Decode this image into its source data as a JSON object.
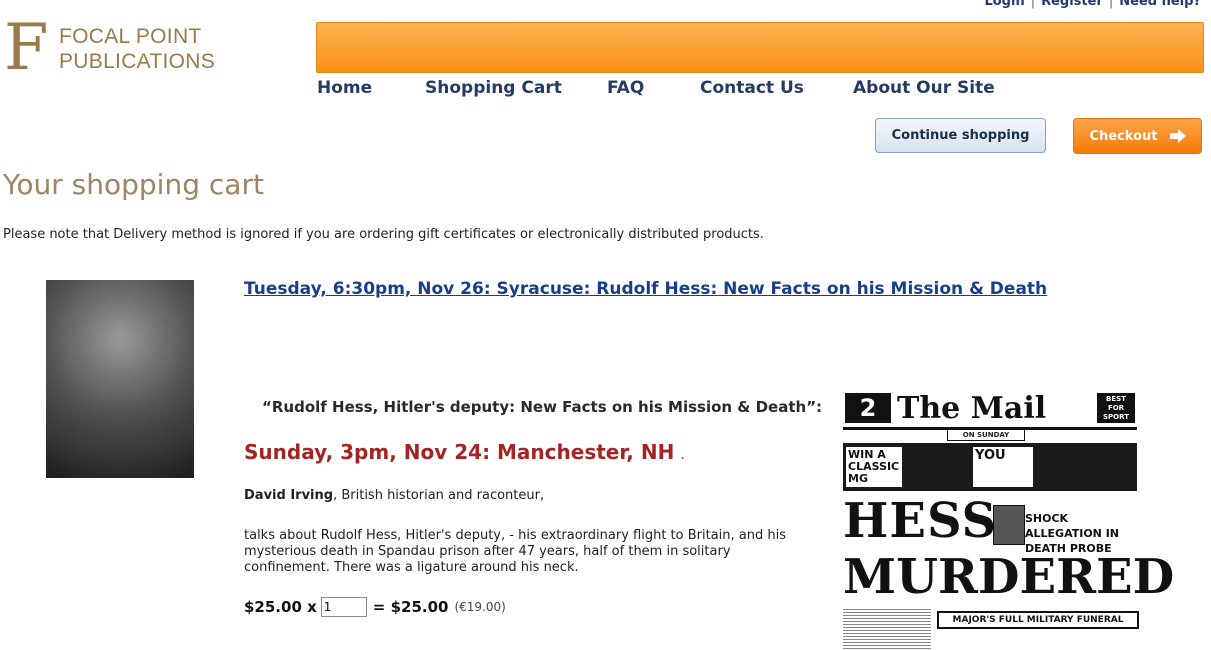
{
  "header": {
    "top_links": [
      "Login",
      "Register",
      "Need help?"
    ],
    "logo": {
      "letter": "F",
      "line1": "FOCAL POINT",
      "line2": "PUBLICATIONS"
    },
    "nav": [
      "Home",
      "Shopping Cart",
      "FAQ",
      "Contact Us",
      "About Our Site"
    ]
  },
  "buttons": {
    "continue": "Continue shopping",
    "checkout": "Checkout"
  },
  "page": {
    "title": "Your shopping cart",
    "note": "Please note that Delivery method is ignored if you are ordering gift certificates or electronically distributed products."
  },
  "item": {
    "link_text": "Tuesday, 6:30pm, Nov 26: Syracuse: Rudolf Hess: New Facts on his Mission & Death",
    "quote": "“Rudolf Hess, Hitler's deputy: New Facts on his Mission & Death”:",
    "date_line": "Sunday, 3pm, Nov 24: Manchester, NH",
    "date_dot": ".",
    "author_name": "David Irving",
    "author_rest": ", British historian and raconteur,",
    "description": "talks about  Rudolf Hess, Hitler's deputy, - his extraordinary flight to Britain, and his mysterious death in Spandau prison after 47 years, half of them in solitary confinement. There was a ligature around his neck.",
    "unit_price": "$25.00 x",
    "quantity": "1",
    "total": "= $25.00",
    "total_eur": "(€19.00)"
  },
  "newspaper": {
    "number": "2",
    "title": "The Mail",
    "badge": "BEST FOR SPORT",
    "sunday": "ON SUNDAY",
    "win": "WIN A CLASSIC MG",
    "you": "YOU",
    "headline1": "HESS",
    "shock": "SHOCK ALLEGATION IN DEATH PROBE",
    "headline2": "MURDERED",
    "funeral": "MAJOR'S FULL MILITARY FUNERAL"
  }
}
